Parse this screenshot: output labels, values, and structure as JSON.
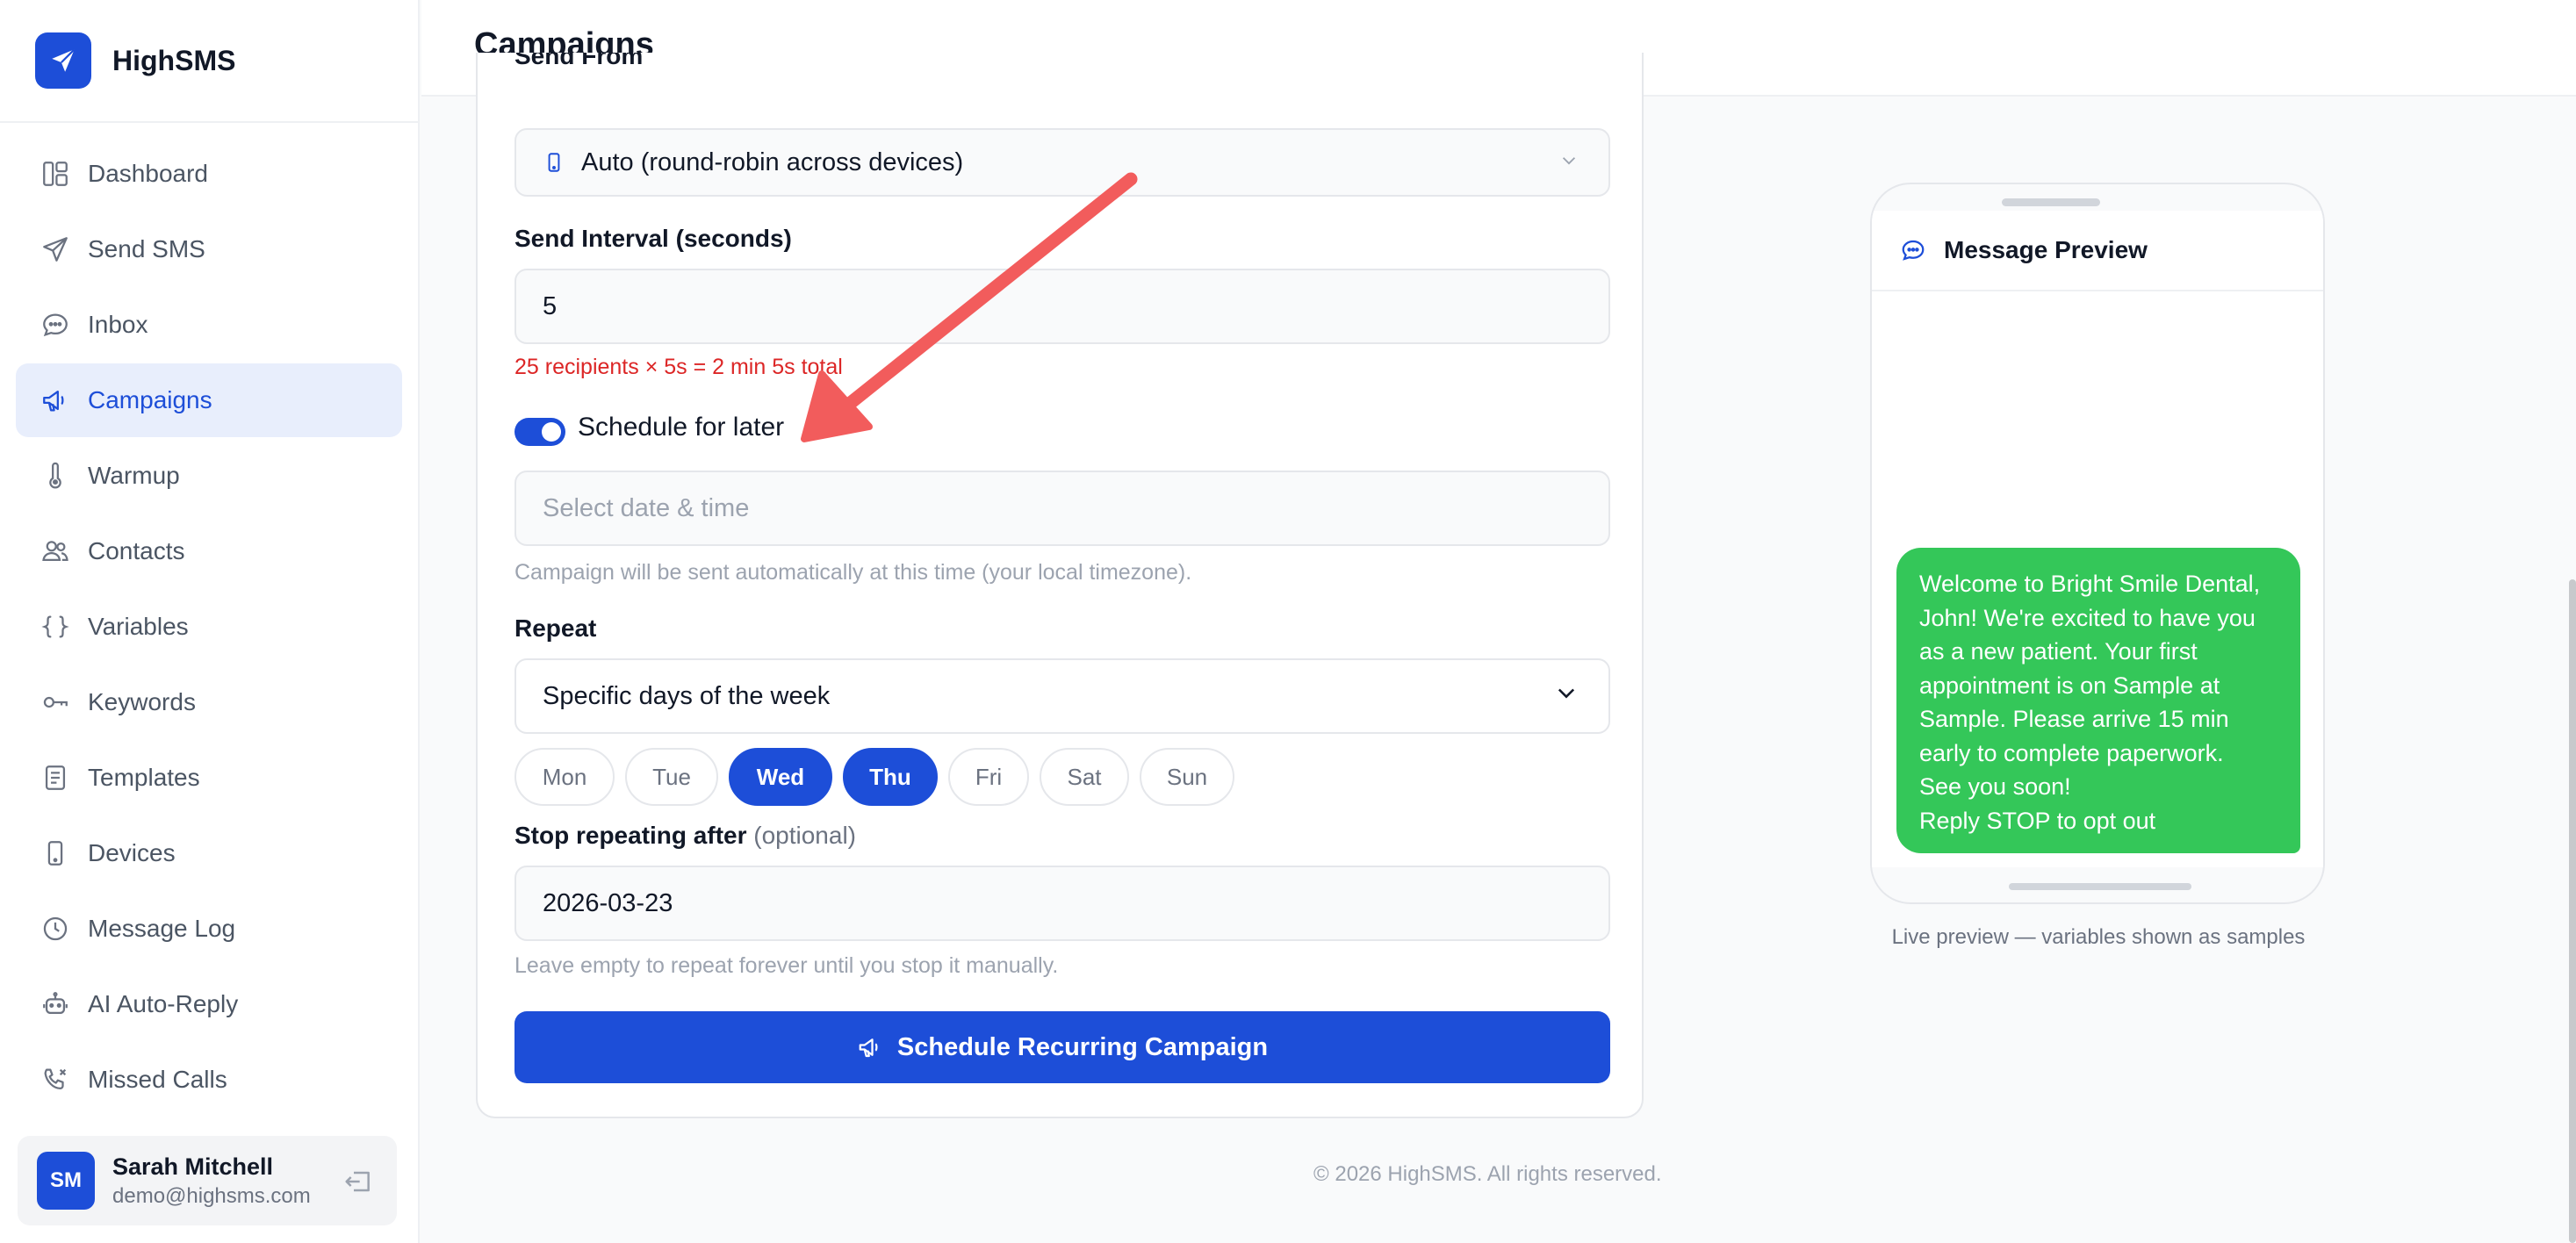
{
  "app": {
    "name": "HighSMS"
  },
  "sidebar": {
    "items": [
      {
        "label": "Dashboard",
        "icon": "dashboard-icon",
        "active": false
      },
      {
        "label": "Send SMS",
        "icon": "send-icon",
        "active": false
      },
      {
        "label": "Inbox",
        "icon": "chat-icon",
        "active": false
      },
      {
        "label": "Campaigns",
        "icon": "megaphone-icon",
        "active": true
      },
      {
        "label": "Warmup",
        "icon": "thermometer-icon",
        "active": false
      },
      {
        "label": "Contacts",
        "icon": "users-icon",
        "active": false
      },
      {
        "label": "Variables",
        "icon": "braces-icon",
        "active": false
      },
      {
        "label": "Keywords",
        "icon": "key-icon",
        "active": false
      },
      {
        "label": "Templates",
        "icon": "document-icon",
        "active": false
      },
      {
        "label": "Devices",
        "icon": "phone-icon",
        "active": false
      },
      {
        "label": "Message Log",
        "icon": "clock-icon",
        "active": false
      },
      {
        "label": "AI Auto-Reply",
        "icon": "robot-icon",
        "active": false
      },
      {
        "label": "Missed Calls",
        "icon": "missed-call-icon",
        "active": false
      }
    ],
    "user": {
      "initials": "SM",
      "name": "Sarah Mitchell",
      "email": "demo@highsms.com"
    }
  },
  "header": {
    "title": "Campaigns"
  },
  "form": {
    "send_from": {
      "label": "Send From",
      "value": "Auto (round-robin across devices)"
    },
    "interval": {
      "label": "Send Interval (seconds)",
      "value": "5",
      "calc": "25 recipients × 5s = 2 min 5s total"
    },
    "schedule": {
      "label": "Schedule for later",
      "enabled": true,
      "placeholder": "Select date & time",
      "help": "Campaign will be sent automatically at this time (your local timezone)."
    },
    "repeat": {
      "label": "Repeat",
      "value": "Specific days of the week"
    },
    "days": [
      {
        "label": "Mon",
        "selected": false
      },
      {
        "label": "Tue",
        "selected": false
      },
      {
        "label": "Wed",
        "selected": true
      },
      {
        "label": "Thu",
        "selected": true
      },
      {
        "label": "Fri",
        "selected": false
      },
      {
        "label": "Sat",
        "selected": false
      },
      {
        "label": "Sun",
        "selected": false
      }
    ],
    "stop_after": {
      "label": "Stop repeating after",
      "optional": "(optional)",
      "value": "2026-03-23",
      "help": "Leave empty to repeat forever until you stop it manually."
    },
    "submit_label": "Schedule Recurring Campaign"
  },
  "preview": {
    "title": "Message Preview",
    "message_lines": [
      "Welcome to Bright Smile Dental,",
      "John! We're excited to have you",
      "as a new patient. Your first",
      "appointment is on Sample at",
      "Sample. Please arrive 15 min",
      "early to complete paperwork.",
      "See you soon!",
      "Reply STOP to opt out"
    ],
    "caption": "Live preview — variables shown as samples"
  },
  "footer": {
    "text": "© 2026 HighSMS. All rights reserved."
  },
  "colors": {
    "primary": "#1d4ed8",
    "bubble": "#34c759",
    "warning": "#dc2626",
    "annotation": "#f25c5c"
  }
}
